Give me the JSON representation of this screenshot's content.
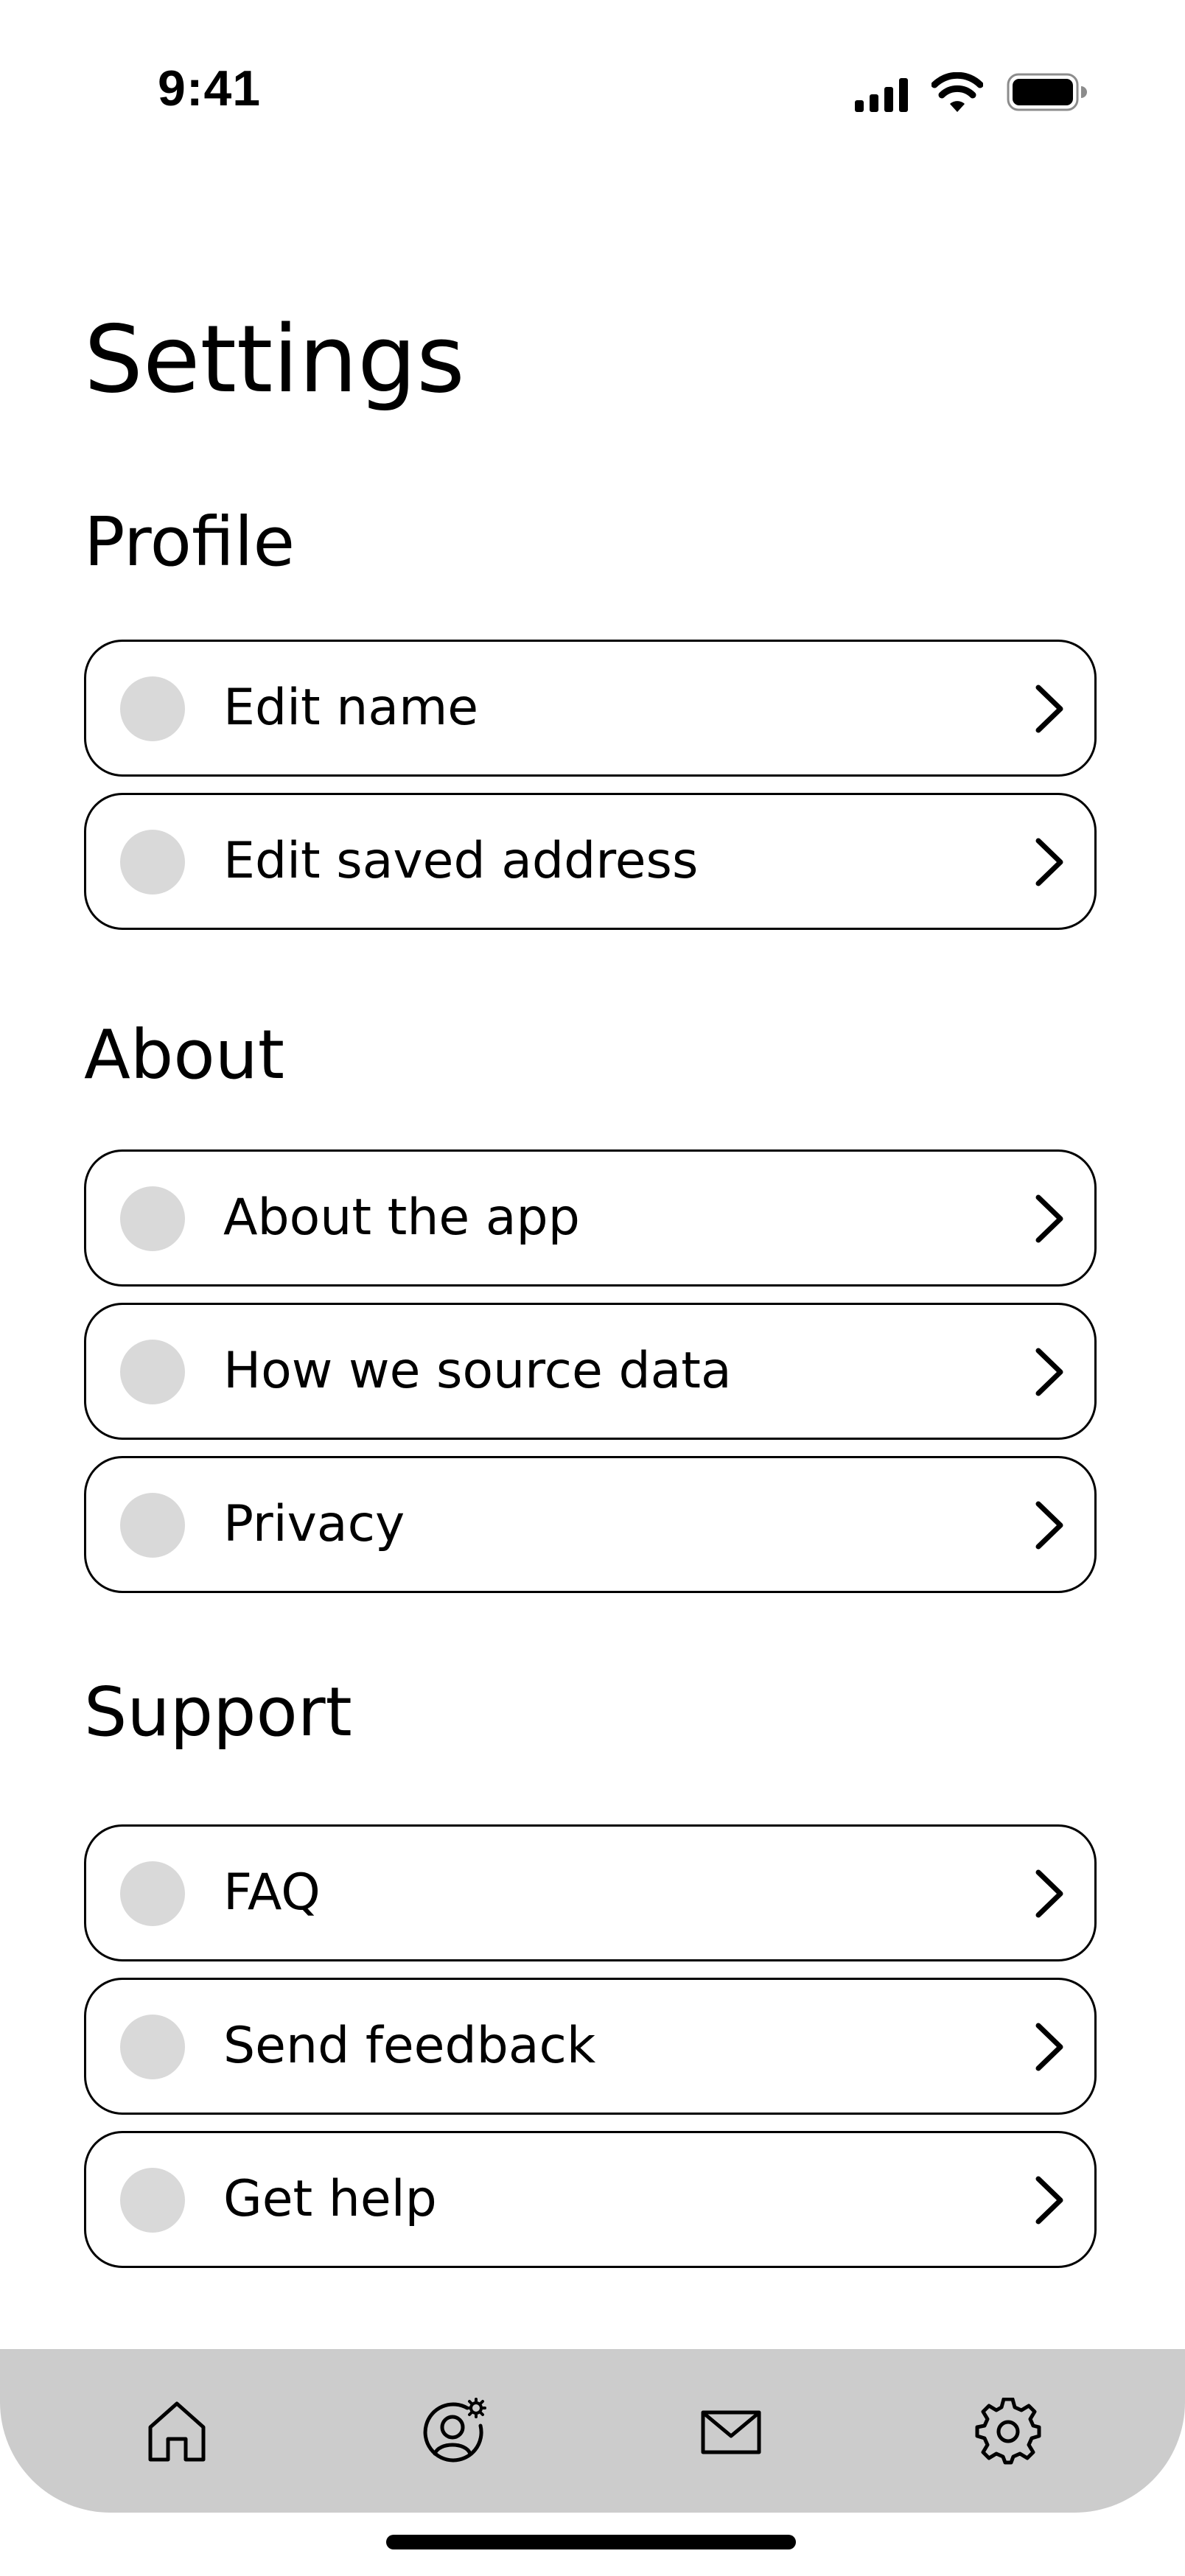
{
  "status_bar": {
    "time": "9:41",
    "icons": [
      "cellular-signal-icon",
      "wifi-icon",
      "battery-icon"
    ]
  },
  "page": {
    "title": "Settings"
  },
  "sections": [
    {
      "title": "Profile",
      "items": [
        {
          "label": "Edit name"
        },
        {
          "label": "Edit saved address"
        }
      ]
    },
    {
      "title": "About",
      "items": [
        {
          "label": "About the app"
        },
        {
          "label": "How we source data"
        },
        {
          "label": "Privacy"
        }
      ]
    },
    {
      "title": "Support",
      "items": [
        {
          "label": "FAQ"
        },
        {
          "label": "Send feedback"
        },
        {
          "label": "Get help"
        }
      ]
    }
  ],
  "tab_bar": {
    "tabs": [
      {
        "icon": "home-icon"
      },
      {
        "icon": "profile-settings-icon"
      },
      {
        "icon": "mail-icon"
      },
      {
        "icon": "gear-icon"
      }
    ]
  },
  "colors": {
    "background": "#ffffff",
    "text": "#000000",
    "placeholder_dot": "#d9d9d9",
    "tab_bar": "#cccccc"
  }
}
